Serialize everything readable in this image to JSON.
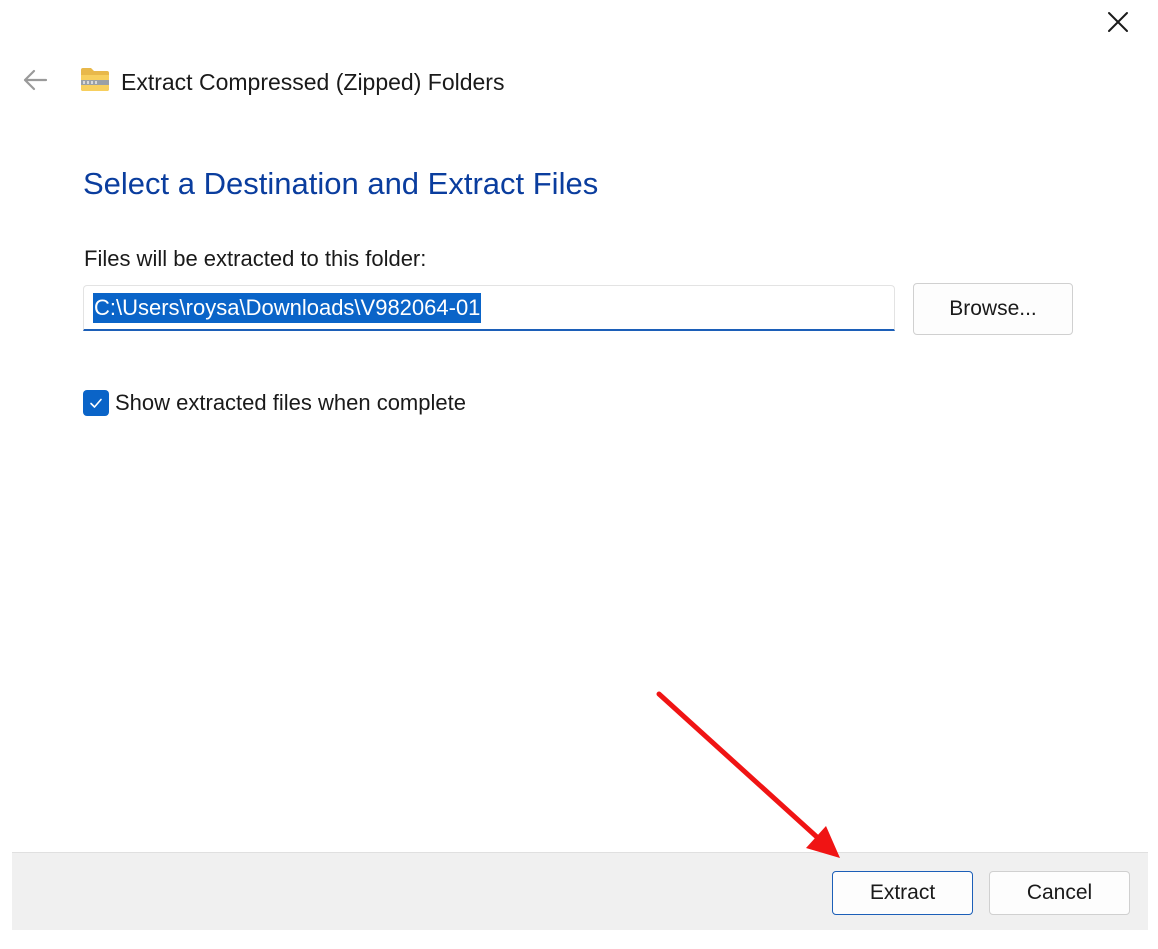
{
  "window": {
    "title": "Extract Compressed (Zipped) Folders",
    "icons": {
      "close": "close-icon",
      "back": "back-arrow-icon",
      "app": "zip-folder-icon"
    }
  },
  "page": {
    "heading": "Select a Destination and Extract Files",
    "field_label": "Files will be extracted to this folder:",
    "destination_path": "C:\\Users\\roysa\\Downloads\\V982064-01",
    "browse_label": "Browse...",
    "show_files_label": "Show extracted files when complete",
    "show_files_checked": true
  },
  "footer": {
    "extract_label": "Extract",
    "cancel_label": "Cancel"
  },
  "annotation": {
    "type": "arrow",
    "color": "#f01414",
    "points_to": "extract-button"
  },
  "colors": {
    "heading": "#0a3d9e",
    "accent": "#0a64c8",
    "footer_bg": "#f0f0f0"
  }
}
